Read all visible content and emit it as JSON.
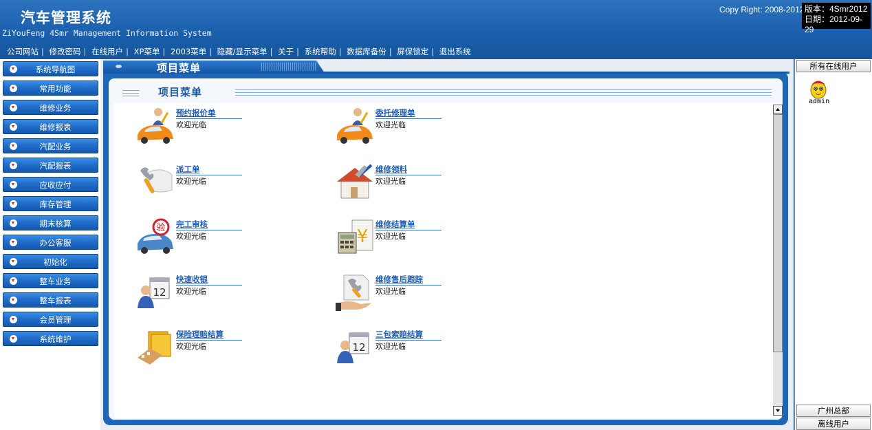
{
  "header": {
    "title": "汽车管理系统",
    "subtitle": "ZiYouFeng 4Smr Management Information System",
    "copyright": "Copy Right: 2008-2012",
    "version": "版本：4Smr2012",
    "date": "日期：2012-09-29",
    "menu": [
      "公司网站",
      "修改密码",
      "在线用户",
      "XP菜单",
      "2003菜单",
      "隐藏/显示菜单",
      "关于",
      "系统帮助",
      "数据库备份",
      "屏保锁定",
      "退出系统"
    ]
  },
  "sidebar": {
    "items": [
      "系统导航图",
      "常用功能",
      "维修业务",
      "维修报表",
      "汽配业务",
      "汽配报表",
      "应收应付",
      "库存管理",
      "期末核算",
      "办公客服",
      "初始化",
      "整车业务",
      "整车报表",
      "会员管理",
      "系统维护"
    ]
  },
  "main": {
    "tab_title": "项目菜单",
    "panel_title": "项目菜单",
    "items": [
      {
        "title": "预约报价单",
        "desc": "欢迎光临",
        "icon": "car-user-icon"
      },
      {
        "title": "委托修理单",
        "desc": "欢迎光临",
        "icon": "car-user-icon"
      },
      {
        "title": "派工单",
        "desc": "欢迎光临",
        "icon": "wrench-hand-icon"
      },
      {
        "title": "维修领料",
        "desc": "欢迎光临",
        "icon": "house-tools-icon"
      },
      {
        "title": "完工审核",
        "desc": "欢迎光临",
        "icon": "car-inspect-icon"
      },
      {
        "title": "维修结算单",
        "desc": "欢迎光临",
        "icon": "calculator-yen-icon"
      },
      {
        "title": "快速收银",
        "desc": "欢迎光临",
        "icon": "calendar-user-icon"
      },
      {
        "title": "维修售后跟踪",
        "desc": "欢迎光临",
        "icon": "wrench-doc-icon"
      },
      {
        "title": "保险理赔结算",
        "desc": "欢迎光临",
        "icon": "folder-tools-icon"
      },
      {
        "title": "三包索赔结算",
        "desc": "欢迎光临",
        "icon": "calendar-user-icon"
      }
    ]
  },
  "right_panel": {
    "title": "所有在线用户",
    "users": [
      "admin"
    ],
    "location": "广州总部",
    "offline": "离线用户"
  },
  "colors": {
    "header_blue": "#1a60ad",
    "nav_blue": "#1f6cc9",
    "link_blue": "#1f5fbf",
    "panel_blue": "#1d67b6"
  }
}
